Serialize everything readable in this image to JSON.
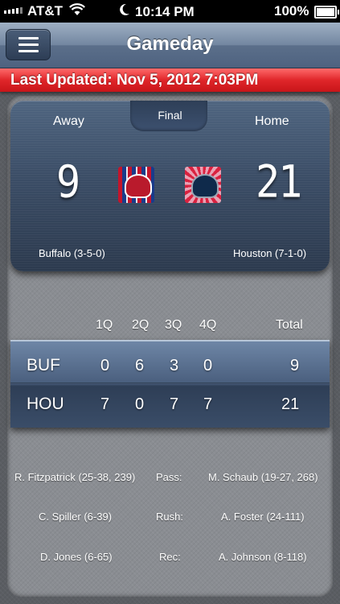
{
  "status_bar": {
    "carrier": "AT&T",
    "wifi_icon": "wifi-icon",
    "moon_icon": "moon-icon",
    "time": "10:14 PM",
    "battery_pct": "100%"
  },
  "nav": {
    "menu_icon": "hamburger-menu-icon",
    "title": "Gameday"
  },
  "update_bar": {
    "text": "Last Updated: Nov 5, 2012 7:03PM",
    "color": "#e0262a"
  },
  "game": {
    "away_label": "Away",
    "home_label": "Home",
    "status": "Final",
    "away_score": "9",
    "home_score": "21",
    "away_record": "Buffalo (3-5-0)",
    "home_record": "Houston (7-1-0)",
    "away_logo": "buffalo-bills-logo",
    "home_logo": "houston-texans-logo"
  },
  "linescore": {
    "headers": [
      "1Q",
      "2Q",
      "3Q",
      "4Q",
      "Total"
    ],
    "rows": [
      {
        "team": "BUF",
        "q": [
          "0",
          "6",
          "3",
          "0"
        ],
        "total": "9"
      },
      {
        "team": "HOU",
        "q": [
          "7",
          "0",
          "7",
          "7"
        ],
        "total": "21"
      }
    ]
  },
  "leaders": [
    {
      "away": "R. Fitzpatrick (25-38, 239)",
      "category": "Pass:",
      "home": "M. Schaub (19-27, 268)"
    },
    {
      "away": "C. Spiller (6-39)",
      "category": "Rush:",
      "home": "A. Foster (24-111)"
    },
    {
      "away": "D. Jones (6-65)",
      "category": "Rec:",
      "home": "A. Johnson (8-118)"
    }
  ]
}
